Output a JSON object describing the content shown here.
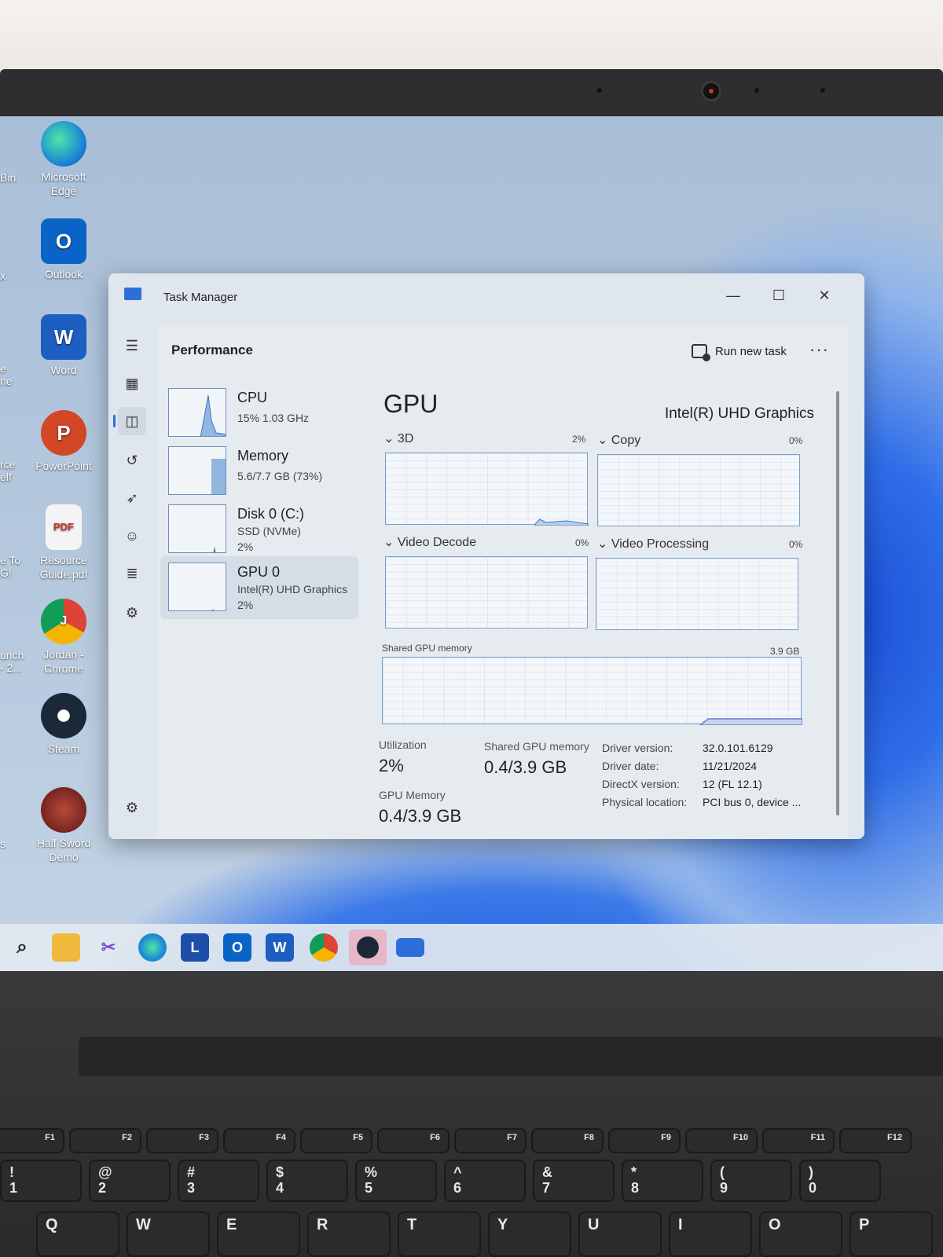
{
  "desktop": {
    "cut_labels": [
      "Bin",
      "x",
      "e\nne",
      "rce\nelf",
      "e To\nG!",
      "unch\n- 2...",
      "s"
    ],
    "icons": [
      {
        "name": "edge",
        "label": "Microsoft Edge",
        "glyph": "",
        "color": "#1c8ad6"
      },
      {
        "name": "outlook",
        "label": "Outlook",
        "glyph": "O",
        "color": "#0a64c8"
      },
      {
        "name": "word",
        "label": "Word",
        "glyph": "W",
        "color": "#1d5fc1"
      },
      {
        "name": "powerpoint",
        "label": "PowerPoint",
        "glyph": "P",
        "color": "#d24726"
      },
      {
        "name": "pdf",
        "label": "Resource Guide.pdf",
        "glyph": "PDF",
        "color": "#f2f2f2"
      },
      {
        "name": "chrome",
        "label": "Jordan - Chrome",
        "glyph": "J",
        "color": "#e0a62b"
      },
      {
        "name": "steam",
        "label": "Steam",
        "glyph": "",
        "color": "#1b2838"
      },
      {
        "name": "halfsword",
        "label": "Half Sword Demo",
        "glyph": "",
        "color": "#7a1f1f"
      }
    ]
  },
  "window": {
    "title": "Task Manager",
    "minimize": "—",
    "maximize": "☐",
    "close": "✕"
  },
  "header": {
    "title": "Performance",
    "run_new_task": "Run new task",
    "more": "···"
  },
  "side": {
    "items": [
      {
        "name": "CPU",
        "line1": "15% 1.03 GHz",
        "line2": ""
      },
      {
        "name": "Memory",
        "line1": "5.6/7.7 GB (73%)",
        "line2": ""
      },
      {
        "name": "Disk 0 (C:)",
        "line1": "SSD (NVMe)",
        "line2": "2%"
      },
      {
        "name": "GPU 0",
        "line1": "Intel(R) UHD Graphics",
        "line2": "2%"
      }
    ]
  },
  "gpu": {
    "title": "GPU",
    "model": "Intel(R) UHD Graphics",
    "engines": [
      {
        "label": "3D",
        "pct": "2%"
      },
      {
        "label": "Copy",
        "pct": "0%"
      },
      {
        "label": "Video Decode",
        "pct": "0%"
      },
      {
        "label": "Video Processing",
        "pct": "0%"
      }
    ],
    "shared_label": "Shared GPU memory",
    "shared_max": "3.9 GB",
    "utilization_label": "Utilization",
    "utilization_value": "2%",
    "shared_mem_label": "Shared GPU memory",
    "shared_mem_value": "0.4/3.9 GB",
    "gpu_mem_label": "GPU Memory",
    "gpu_mem_value": "0.4/3.9 GB",
    "info": [
      {
        "key": "Driver version:",
        "value": "32.0.101.6129"
      },
      {
        "key": "Driver date:",
        "value": "11/21/2024"
      },
      {
        "key": "DirectX version:",
        "value": "12 (FL 12.1)"
      },
      {
        "key": "Physical location:",
        "value": "PCI bus 0, device ..."
      }
    ]
  },
  "taskbar": {
    "icons": [
      "search-icon",
      "file-explorer-icon",
      "snipping-icon",
      "edge-icon",
      "l-app-icon",
      "outlook-icon",
      "word-icon",
      "chrome-icon",
      "steam-icon",
      "task-manager-icon"
    ]
  },
  "keyboard": {
    "fn_row": [
      "F1",
      "F2",
      "F3",
      "F4",
      "F5",
      "F6",
      "F7",
      "F8",
      "F9",
      "F10",
      "F11",
      "F12"
    ],
    "num_row": [
      "1",
      "2",
      "3",
      "4",
      "5",
      "6",
      "7",
      "8",
      "9",
      "0"
    ],
    "num_shift": [
      "!",
      "@",
      "#",
      "$",
      "%",
      "^",
      "&",
      "*",
      "(",
      ")"
    ],
    "letter_row": [
      "Q",
      "W",
      "E",
      "R",
      "T",
      "Y",
      "U",
      "I",
      "O",
      "P"
    ]
  }
}
